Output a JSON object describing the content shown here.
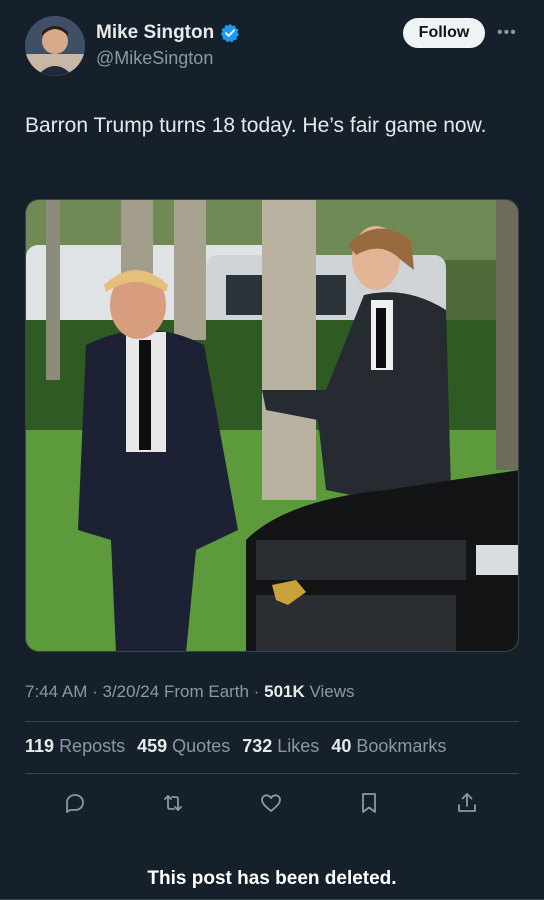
{
  "author": {
    "display_name": "Mike Sington",
    "handle": "@MikeSington",
    "verified_icon": "verified-badge-icon",
    "avatar_icon": "avatar"
  },
  "follow_label": "Follow",
  "more_icon": "more-options-icon",
  "tweet": {
    "text": "Barron Trump turns 18 today. He’s fair game now."
  },
  "meta": {
    "time": "7:44 AM",
    "date": "3/20/24",
    "source": "From Earth",
    "views_count": "501K",
    "views_label": "Views"
  },
  "stats": {
    "reposts_count": "119",
    "reposts_label": "Reposts",
    "quotes_count": "459",
    "quotes_label": "Quotes",
    "likes_count": "732",
    "likes_label": "Likes",
    "bookmarks_count": "40",
    "bookmarks_label": "Bookmarks"
  },
  "actions": [
    "reply-icon",
    "repost-icon",
    "like-icon",
    "bookmark-icon",
    "share-icon"
  ],
  "deleted_notice": "This post has been deleted.",
  "colors": {
    "background": "#15202b",
    "verified": "#1d9bf0",
    "muted": "#8b98a5",
    "text": "#e7e9ea"
  }
}
